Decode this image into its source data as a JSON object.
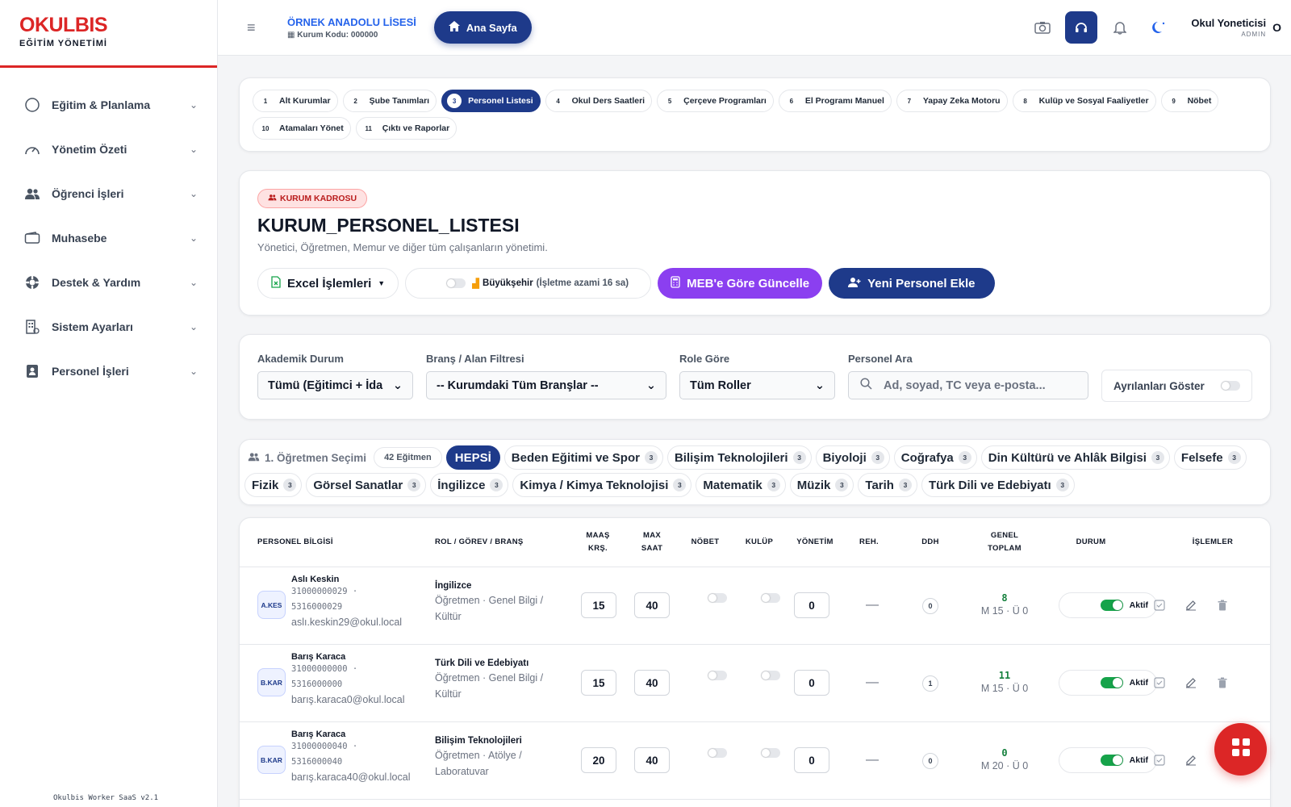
{
  "brand": {
    "title": "OKULBIS",
    "subtitle": "EĞİTİM YÖNETİMİ"
  },
  "sidebar": {
    "items": [
      {
        "label": "Eğitim & Planlama",
        "icon": "circle-icon"
      },
      {
        "label": "Yönetim Özeti",
        "icon": "gauge-icon"
      },
      {
        "label": "Öğrenci İşleri",
        "icon": "users-icon"
      },
      {
        "label": "Muhasebe",
        "icon": "wallet-icon"
      },
      {
        "label": "Destek & Yardım",
        "icon": "lifebuoy-icon"
      },
      {
        "label": "Sistem Ayarları",
        "icon": "building-icon"
      },
      {
        "label": "Personel İşleri",
        "icon": "badge-icon"
      }
    ],
    "footer": "Okulbis Worker SaaS v2.1"
  },
  "header": {
    "school_name": "ÖRNEK ANADOLU LİSESİ",
    "school_code": "Kurum Kodu: 000000",
    "home_label": "Ana Sayfa",
    "user_name": "Okul Yoneticisi",
    "user_role": "ADMIN",
    "avatar": "O"
  },
  "steps": [
    {
      "n": "1",
      "label": "Alt Kurumlar"
    },
    {
      "n": "2",
      "label": "Şube Tanımları"
    },
    {
      "n": "3",
      "label": "Personel Listesi",
      "active": true
    },
    {
      "n": "4",
      "label": "Okul Ders Saatleri"
    },
    {
      "n": "5",
      "label": "Çerçeve Programları"
    },
    {
      "n": "6",
      "label": "El Programı Manuel"
    },
    {
      "n": "7",
      "label": "Yapay Zeka Motoru"
    },
    {
      "n": "8",
      "label": "Kulüp ve Sosyal Faaliyetler"
    },
    {
      "n": "9",
      "label": "Nöbet"
    },
    {
      "n": "10",
      "label": "Atamaları Yönet"
    },
    {
      "n": "11",
      "label": "Çıktı ve Raporlar"
    }
  ],
  "page": {
    "tag": "KURUM KADROSU",
    "title": "KURUM_PERSONEL_LISTESI",
    "subtitle": "Yönetici, Öğretmen, Memur ve diğer tüm çalışanların yönetimi.",
    "excel_label": "Excel İşlemleri",
    "city_label": "Büyükşehir",
    "city_hint": "(İşletme azami 16 sa)",
    "meb_label": "MEB'e Göre Güncelle",
    "add_label": "Yeni Personel Ekle"
  },
  "filters": {
    "academic_label": "Akademik Durum",
    "academic_value": "Tümü (Eğitimci + İda",
    "branch_label": "Branş / Alan Filtresi",
    "branch_value": "-- Kurumdaki Tüm Branşlar --",
    "role_label": "Role Göre",
    "role_value": "Tüm Roller",
    "search_label": "Personel Ara",
    "search_placeholder": "Ad, soyad, TC veya e-posta...",
    "show_left_label": "Ayrılanları Göster"
  },
  "branches": {
    "title": "1. Öğretmen Seçimi",
    "count": "42 Eğitmen",
    "all_label": "HEPSİ",
    "items": [
      {
        "label": "Beden Eğitimi ve Spor",
        "n": "3"
      },
      {
        "label": "Bilişim Teknolojileri",
        "n": "3"
      },
      {
        "label": "Biyoloji",
        "n": "3"
      },
      {
        "label": "Coğrafya",
        "n": "3"
      },
      {
        "label": "Din Kültürü ve Ahlâk Bilgisi",
        "n": "3"
      },
      {
        "label": "Felsefe",
        "n": "3"
      },
      {
        "label": "Fizik",
        "n": "3"
      },
      {
        "label": "Görsel Sanatlar",
        "n": "3"
      },
      {
        "label": "İngilizce",
        "n": "3"
      },
      {
        "label": "Kimya / Kimya Teknolojisi",
        "n": "3"
      },
      {
        "label": "Matematik",
        "n": "3"
      },
      {
        "label": "Müzik",
        "n": "3"
      },
      {
        "label": "Tarih",
        "n": "3"
      },
      {
        "label": "Türk Dili ve Edebiyatı",
        "n": "3"
      }
    ]
  },
  "table": {
    "headers": {
      "person": "PERSONEL BİLGİSİ",
      "role": "ROL / GÖREV / BRANŞ",
      "pay": "MAAŞ KRŞ.",
      "max": "MAX SAAT",
      "duty": "NÖBET",
      "club": "KULÜP",
      "admin": "YÖNETİM",
      "guide": "REH.",
      "ddh": "DDH",
      "total": "GENEL TOPLAM",
      "status": "DURUM",
      "actions": "İŞLEMLER"
    },
    "rows": [
      {
        "initials": "A.KES",
        "name": "Aslı Keskin",
        "tc": "31000000029",
        "phone": "5316000029",
        "email": "aslı.keskin29@okul.local",
        "branch": "İngilizce",
        "role": "Öğretmen · Genel Bilgi / Kültür",
        "pay": "15",
        "max": "40",
        "admin": "0",
        "guide": "—",
        "ddh": "0",
        "total": "8",
        "total_detail": "M 15 · Ü 0",
        "status": "Aktif"
      },
      {
        "initials": "B.KAR",
        "name": "Barış Karaca",
        "tc": "31000000000",
        "phone": "5316000000",
        "email": "barış.karaca0@okul.local",
        "branch": "Türk Dili ve Edebiyatı",
        "role": "Öğretmen · Genel Bilgi / Kültür",
        "pay": "15",
        "max": "40",
        "admin": "0",
        "guide": "—",
        "ddh": "1",
        "total": "11",
        "total_detail": "M 15 · Ü 0",
        "status": "Aktif"
      },
      {
        "initials": "B.KAR",
        "name": "Barış Karaca",
        "tc": "31000000040",
        "phone": "5316000040",
        "email": "barış.karaca40@okul.local",
        "branch": "Bilişim Teknolojileri",
        "role": "Öğretmen · Atölye / Laboratuvar",
        "pay": "20",
        "max": "40",
        "admin": "0",
        "guide": "—",
        "ddh": "0",
        "total": "0",
        "total_detail": "M 20 · Ü 0",
        "status": "Aktif"
      }
    ]
  },
  "colors": {
    "brand_red": "#dc2626",
    "navy": "#1e3a8a",
    "purple": "#8b3ff0",
    "active_green": "#16a34a"
  }
}
